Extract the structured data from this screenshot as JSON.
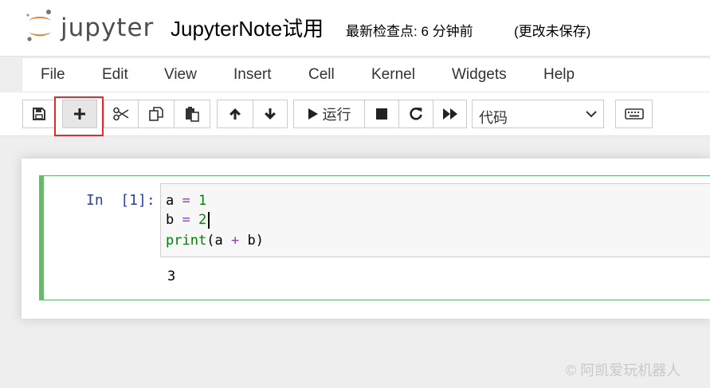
{
  "header": {
    "logo_text": "jupyter",
    "notebook_name": "JupyterNote试用",
    "checkpoint": "最新检查点: 6 分钟前",
    "autosave_status": "(更改未保存)"
  },
  "menu": {
    "items": [
      "File",
      "Edit",
      "View",
      "Insert",
      "Cell",
      "Kernel",
      "Widgets",
      "Help"
    ]
  },
  "toolbar": {
    "run_label": "运行",
    "cell_type": "代码",
    "buttons": [
      "save-icon",
      "plus-icon",
      "cut-icon",
      "copy-icon",
      "paste-icon",
      "arrow-up-icon",
      "arrow-down-icon",
      "play-icon",
      "stop-icon",
      "restart-icon",
      "fast-forward-icon",
      "keyboard-icon"
    ]
  },
  "cell": {
    "prompt": "In  [1]:",
    "code": [
      {
        "var": "a",
        "op": "=",
        "val": "1"
      },
      {
        "var": "b",
        "op": "=",
        "val": "2"
      },
      {
        "fn": "print",
        "open": "(",
        "left": "a",
        "op": "+",
        "right": "b",
        "close": ")"
      }
    ],
    "output": "3"
  },
  "watermark": "© 阿凯爱玩机器人",
  "colors": {
    "selected_cell_border": "#66bb6a",
    "highlight_box": "#e02c2c",
    "prompt_color": "#303f9f",
    "logo_orange": "#f37726"
  }
}
